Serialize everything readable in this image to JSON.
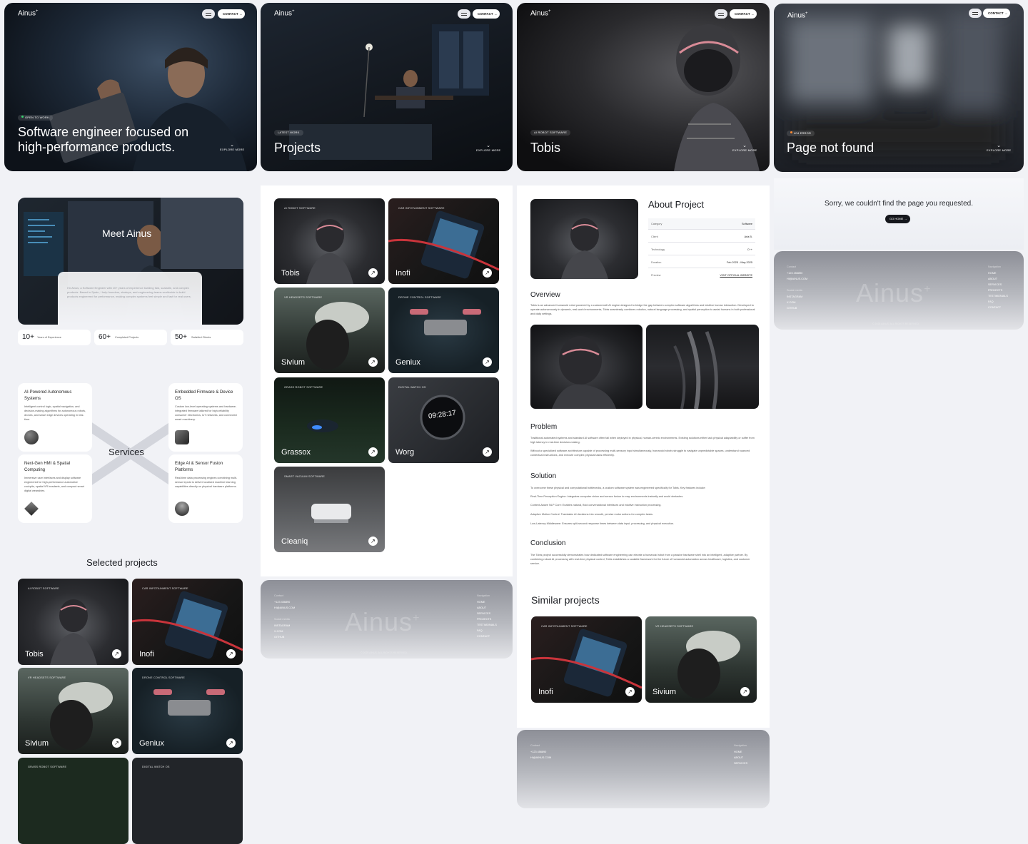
{
  "brand": {
    "name": "Ainus",
    "mark": "+"
  },
  "nav": {
    "contact_label": "CONTACT",
    "contact_arrow": "→"
  },
  "heroes": [
    {
      "chip": "OPEN TO WORK",
      "title_line1": "Software engineer focused on",
      "title_line2": "high-performance products.",
      "explore": "EXPLORE MORE"
    },
    {
      "chip": "LATEST WORK",
      "title": "Projects",
      "explore": "EXPLORE MORE"
    },
    {
      "chip": "AI ROBOT SOFTWARE",
      "title": "Tobis",
      "explore": "EXPLORE MORE"
    },
    {
      "chip": "404 ERROR",
      "title": "Page not found",
      "explore": "EXPLORE MORE"
    }
  ],
  "about": {
    "title": "Meet Ainus",
    "bio": "I'm Ainus, a Software Engineer with 10+ years of experience building fast, scalable, and complex products. Based in Spain, I help founders, startups, and engineering teams worldwide to build products engineered for performance, making complex systems feel simple and fast for real users.",
    "stats": [
      {
        "value": "10+",
        "label": "Years of Experience"
      },
      {
        "value": "60+",
        "label": "Completed Projects"
      },
      {
        "value": "50+",
        "label": "Satisfied Clients"
      }
    ]
  },
  "services": {
    "title": "Services",
    "items": [
      {
        "title": "AI-Powered Autonomous Systems",
        "desc": "Intelligent control logic, spatial navigation, and decision-making algorithms for autonomous robots, drones, and smart edge devices operating in real-time."
      },
      {
        "title": "Embedded Firmware & Device OS",
        "desc": "Custom low-level operating systems and hardware-integrated firmware tailored for high-reliability consumer electronics, IoT networks, and connected smart machinery."
      },
      {
        "title": "Next-Gen HMI & Spatial Computing",
        "desc": "Immersive user interfaces and display software engineered for high-performance automotive cockpits, spatial VR headsets, and compact smart digital wearables."
      },
      {
        "title": "Edge AI & Sensor Fusion Platforms",
        "desc": "Real-time data processing engines combining multi-sensor inputs to deliver localized machine learning capabilities directly on physical hardware platforms."
      }
    ]
  },
  "selected_projects": {
    "title": "Selected projects"
  },
  "projects": [
    {
      "tag": "AI ROBOT SOFTWARE",
      "name": "Tobis"
    },
    {
      "tag": "CAR INFOTAINMENT SOFTWARE",
      "name": "Inofi"
    },
    {
      "tag": "VR HEADSETS SOFTWARE",
      "name": "Sivium"
    },
    {
      "tag": "DRONE CONTROL SOFTWARE",
      "name": "Geniux"
    },
    {
      "tag": "GRASS ROBOT SOFTWARE",
      "name": "Grassox"
    },
    {
      "tag": "DIGITAL WATCH OS",
      "name": "Worg"
    },
    {
      "tag": "SMART VACUUM SOFTWARE",
      "name": "Cleaniq"
    }
  ],
  "watch_time": "09:28:17",
  "project_detail": {
    "title": "About Project",
    "info": [
      {
        "k": "Category",
        "v": "Software"
      },
      {
        "k": "Client",
        "v": "Arla B."
      },
      {
        "k": "Technology",
        "v": "C++"
      },
      {
        "k": "Duration",
        "v": "Feb 2025 - May 2025"
      },
      {
        "k": "Preview",
        "v": "VISIT OFFICIAL WEBSITE"
      }
    ],
    "overview_title": "Overview",
    "overview": "Tobis is an advanced humanoid robot powered by a custom-built AI engine designed to bridge the gap between complex software algorithms and intuitive human interaction. Developed to operate autonomously in dynamic, real-world environments, Tobis seamlessly combines robotics, natural language processing, and spatial perception to assist humans in both professional and daily settings.",
    "problem_title": "Problem",
    "problem_p1": "Traditional automated systems and standard AI software often fail when deployed in physical, human-centric environments. Existing solutions either lack physical adaptability or suffer from high latency in real-time decision-making.",
    "problem_p2": "Without a specialized software architecture capable of processing multi-sensory input simultaneously, humanoid robots struggle to navigate unpredictable spaces, understand nuanced contextual instructions, and execute complex physical tasks efficiently.",
    "solution_title": "Solution",
    "solution_intro": "To overcome these physical and computational bottlenecks, a custom software system was engineered specifically for Tobis. Key features include:",
    "solution_items": [
      "Real-Time Perception Engine: Integrates computer vision and sensor fusion to map environments instantly and avoid obstacles.",
      "Context-Aware NLP Core: Enables natural, fluid conversational interfaces and intuitive instruction processing.",
      "Adaptive Motion Control: Translates AI decisions into smooth, precise motor actions for complex tasks.",
      "Low-Latency Middleware: Ensures split-second response times between data input, processing, and physical execution."
    ],
    "conclusion_title": "Conclusion",
    "conclusion": "The Tobis project successfully demonstrates how dedicated software engineering can elevate a humanoid robot from a passive hardware shell into an intelligent, adaptive partner. By combining robust AI processing with real-time physical control, Tobis establishes a scalable framework for the future of humanoid automation across healthcare, logistics, and customer service.",
    "similar_title": "Similar projects"
  },
  "not_found": {
    "message": "Sorry, we couldn't find the page you requested.",
    "button": "GO HOME"
  },
  "footer": {
    "contact_label": "Contact",
    "phone": "+123 456890",
    "email": "HI@AINUS.COM",
    "social_label": "Social media",
    "social": [
      "INSTAGRAM",
      "X.COM",
      "GITHUB"
    ],
    "nav_label": "Navigation",
    "nav": [
      "HOME",
      "ABOUT",
      "SERVICES",
      "PROJECTS",
      "TESTIMONIALS",
      "FAQ",
      "CONTACT"
    ],
    "copyright": "© 2025 AINUS. ALL RIGHTS RESERVED."
  },
  "colors": {
    "page_bg": "#f1f2f6",
    "dark": "#15171c",
    "chip_dot": "#38d36f",
    "error_dot": "#ff8a32"
  }
}
